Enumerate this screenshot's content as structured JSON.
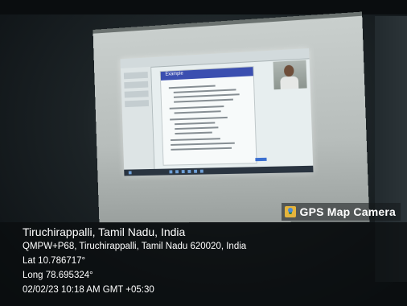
{
  "overlay": {
    "app_badge": "GPS Map Camera",
    "location_title": "Tiruchirappalli, Tamil Nadu, India",
    "address": "QMPW+P68, Tiruchirappalli, Tamil Nadu 620020, India",
    "latitude": "Lat 10.786717°",
    "longitude": "Long 78.695324°",
    "timestamp": "02/02/23 10:18 AM GMT +05:30"
  },
  "projected_slide": {
    "title": "Example"
  },
  "icons": {
    "badge_icon": "map-pin-icon"
  }
}
